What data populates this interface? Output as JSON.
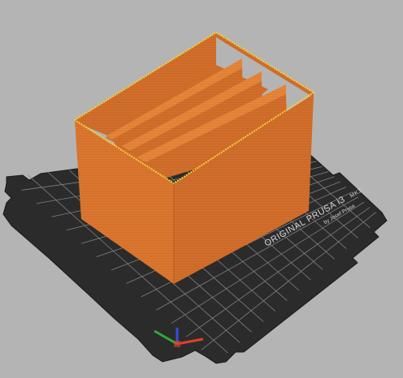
{
  "printer": {
    "name": "ORIGINAL PRUSA i3 MK3",
    "name_main": "ORIGINAL PRUSA i3",
    "name_model": "MK3",
    "maker": "by Josef Prusa"
  },
  "model": {
    "type": "divided box",
    "compartments": 4,
    "color": "#e07a2f"
  },
  "scene": {
    "background_color": "#b4b4b4",
    "bed_color": "#2b2b2b",
    "grid_color": "#8a8a8a"
  },
  "axes": {
    "x_color": "#e0402a",
    "y_color": "#2faa3a",
    "z_color": "#3050e0"
  }
}
